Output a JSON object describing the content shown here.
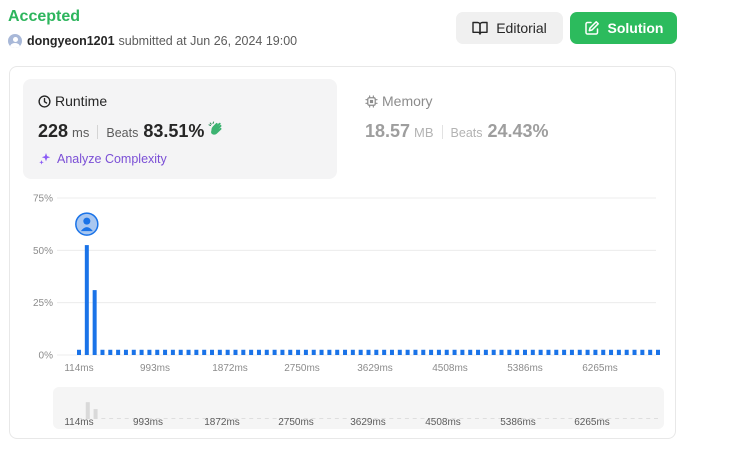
{
  "header": {
    "status": "Accepted",
    "username": "dongyeon1201",
    "submitted_text": "submitted at Jun 26, 2024 19:00",
    "editorial_label": "Editorial",
    "solution_label": "Solution"
  },
  "runtime": {
    "title": "Runtime",
    "value": "228",
    "unit": "ms",
    "beats_label": "Beats",
    "beats_value": "83.51%",
    "analyze_label": "Analyze Complexity"
  },
  "memory": {
    "title": "Memory",
    "value": "18.57",
    "unit": "MB",
    "beats_label": "Beats",
    "beats_value": "24.43%"
  },
  "colors": {
    "accepted": "#2db55d",
    "solution_button": "#2cbb5d",
    "bar": "#1a73e8",
    "analyze": "#7b4fd6"
  },
  "chart_data": {
    "type": "bar",
    "ylim": [
      0,
      75
    ],
    "yticks": [
      "0%",
      "25%",
      "50%",
      "75%"
    ],
    "x_tick_labels": [
      "114ms",
      "993ms",
      "1872ms",
      "2750ms",
      "3629ms",
      "4508ms",
      "5386ms",
      "6265ms"
    ],
    "values": [
      2.5,
      52.5,
      31,
      2.5,
      2.5,
      2.5,
      2.5,
      2.5,
      2.5,
      2.5,
      2.5,
      2.5,
      2.5,
      2.5,
      2.5,
      2.5,
      2.5,
      2.5,
      2.5,
      2.5,
      2.5,
      2.5,
      2.5,
      2.5,
      2.5,
      2.5,
      2.5,
      2.5,
      2.5,
      2.5,
      2.5,
      2.5,
      2.5,
      2.5,
      2.5,
      2.5,
      2.5,
      2.5,
      2.5,
      2.5,
      2.5,
      2.5,
      2.5,
      2.5,
      2.5,
      2.5,
      2.5,
      2.5,
      2.5,
      2.5,
      2.5,
      2.5,
      2.5,
      2.5,
      2.5,
      2.5,
      2.5,
      2.5,
      2.5,
      2.5,
      2.5,
      2.5,
      2.5,
      2.5,
      2.5,
      2.5,
      2.5,
      2.5,
      2.5,
      2.5,
      2.5,
      2.5,
      2.5,
      2.5,
      2.5
    ],
    "highlight_index": 1,
    "grid": true,
    "navigator": true
  }
}
